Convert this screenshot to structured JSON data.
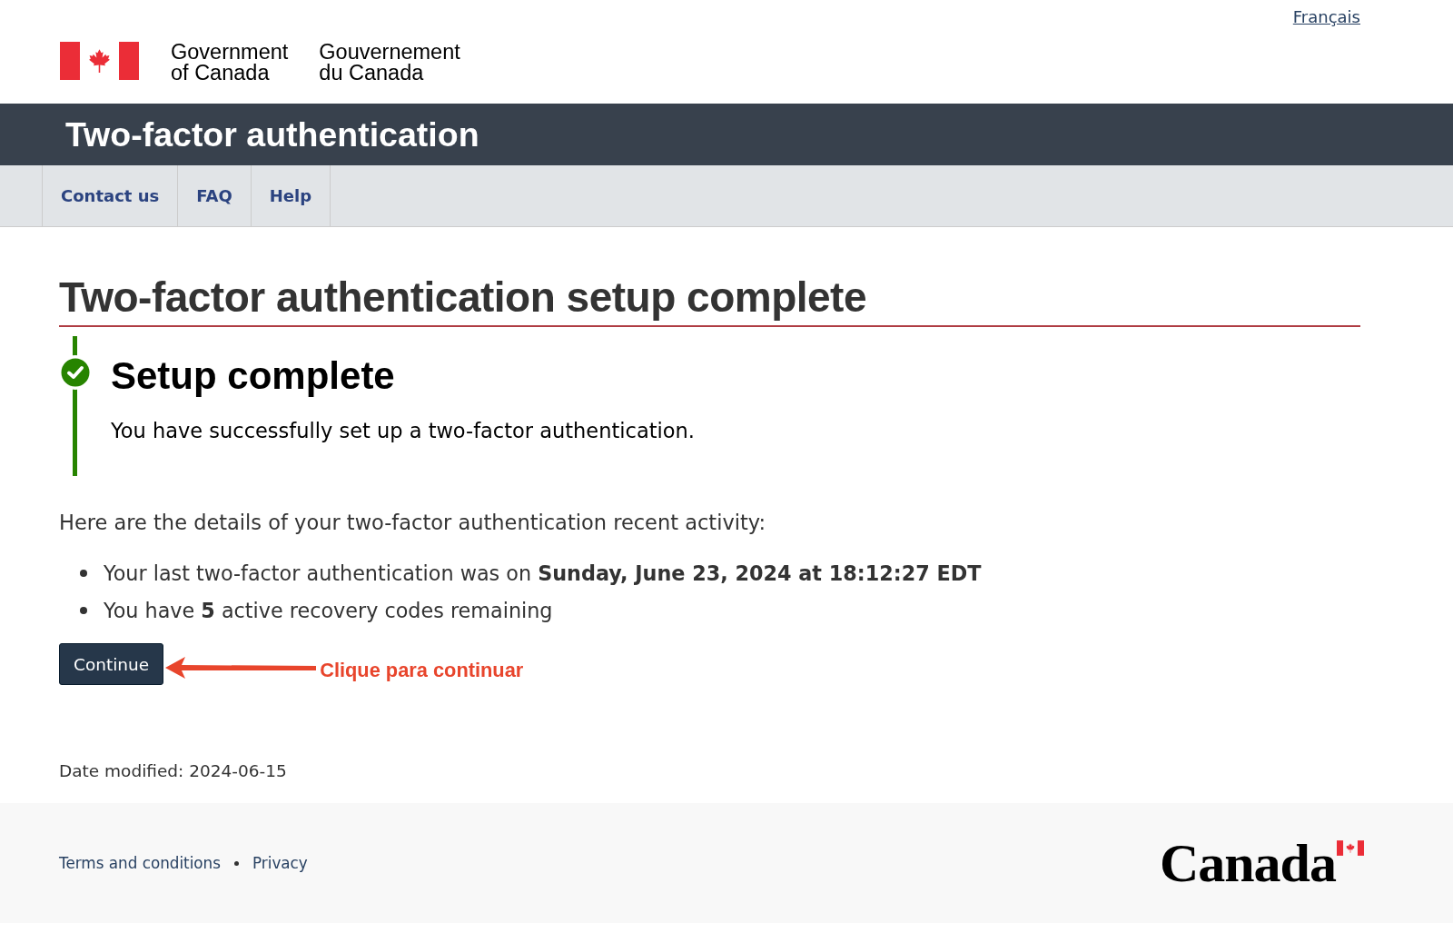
{
  "header": {
    "language_link": "Français",
    "signature_en": [
      "Government",
      "of Canada"
    ],
    "signature_fr": [
      "Gouvernement",
      "du Canada"
    ]
  },
  "app_bar": {
    "title": "Two-factor authentication"
  },
  "nav": {
    "items": [
      {
        "label": "Contact us"
      },
      {
        "label": "FAQ"
      },
      {
        "label": "Help"
      }
    ]
  },
  "main": {
    "title": "Two-factor authentication setup complete",
    "alert": {
      "kind": "success",
      "title": "Setup complete",
      "text": "You have successfully set up a two-factor authentication."
    },
    "intro": "Here are the details of your two-factor authentication recent activity:",
    "details": [
      "Your last two-factor authentication was on **Sunday, June 23, 2024 at 18:12:27 EDT**",
      "You have **5** active recovery codes remaining"
    ],
    "button": "Continue",
    "annotation": "Clique para continuar",
    "date_modified": "Date modified: 2024-06-15"
  },
  "footer": {
    "links": [
      "Terms and conditions",
      "Privacy"
    ],
    "wordmark": "Canada"
  }
}
